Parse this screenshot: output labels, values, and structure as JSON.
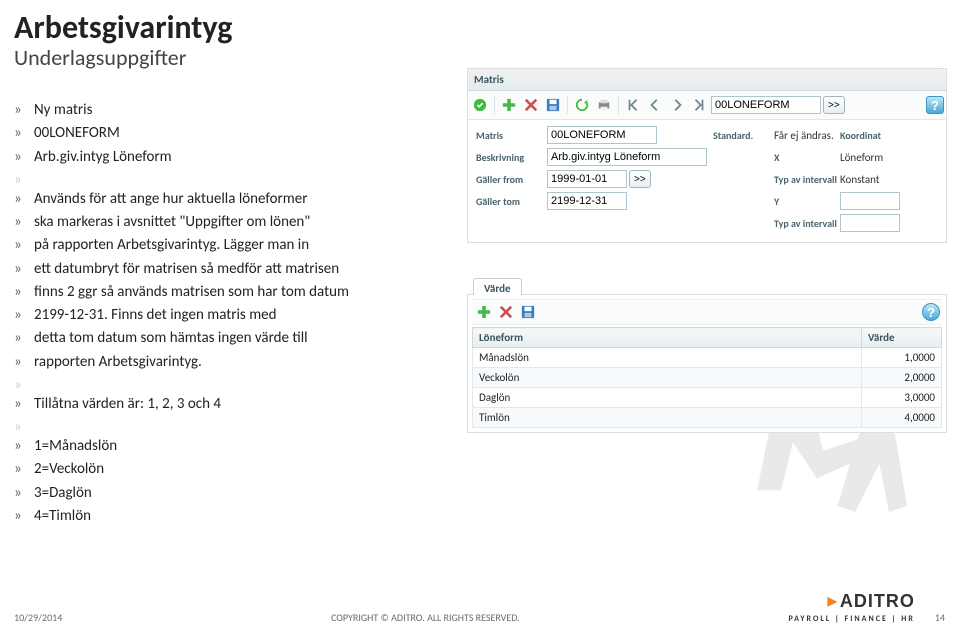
{
  "page": {
    "title": "Arbetsgivarintyg",
    "subtitle": "Underlagsuppgifter"
  },
  "bullets": {
    "b0": "Ny matris",
    "b1": "00LONEFORM",
    "b2": "Arb.giv.intyg Löneform",
    "b3": "Används för att ange hur aktuella löneformer",
    "b4": "ska markeras i avsnittet \"Uppgifter om lönen\"",
    "b5": "på rapporten Arbetsgivarintyg. Lägger man in",
    "b6": "ett datumbryt för matrisen så medför att matrisen",
    "b7": "finns 2 ggr så används matrisen som har tom datum",
    "b8": "2199-12-31. Finns det ingen matris med",
    "b9": "detta tom datum som hämtas ingen värde till",
    "b10": "rapporten Arbetsgivarintyg.",
    "b11": "Tillåtna värden är: 1, 2, 3 och 4",
    "b12": "1=Månadslön",
    "b13": "2=Veckolön",
    "b14": "3=Daglön",
    "b15": "4=Timlön"
  },
  "panel": {
    "header": "Matris",
    "lookup": {
      "value": "00LONEFORM",
      "go": ">>"
    },
    "form": {
      "matris_lbl": "Matris",
      "matris_val": "00LONEFORM",
      "standard_lbl": "Standard.",
      "standard_val": "Får ej ändras.",
      "koordinat_lbl": "Koordinat",
      "beskriv_lbl": "Beskrivning",
      "beskriv_val": "Arb.giv.intyg Löneform",
      "x_lbl": "X",
      "x_val": "Löneform",
      "gfrom_lbl": "Gäller from",
      "gfrom_val": "1999-01-01",
      "typint_lbl": "Typ av intervall",
      "typint_val": "Konstant",
      "gtom_lbl": "Gäller tom",
      "gtom_val": "2199-12-31",
      "y_lbl": "Y",
      "typint2_lbl": "Typ av intervall"
    }
  },
  "subtab": {
    "title": "Värde",
    "col1": "Löneform",
    "col2": "Värde",
    "rows": [
      {
        "name": "Månadslön",
        "val": "1,0000"
      },
      {
        "name": "Veckolön",
        "val": "2,0000"
      },
      {
        "name": "Daglön",
        "val": "3,0000"
      },
      {
        "name": "Timlön",
        "val": "4,0000"
      }
    ]
  },
  "footer": {
    "date": "10/29/2014",
    "copyright": "COPYRIGHT © ADITRO. ALL RIGHTS RESERVED.",
    "page_no": "14",
    "logo_name": "ADITRO",
    "logo_tag": "PAYROLL | FINANCE | HR"
  },
  "icons": {
    "reload": "reload",
    "add": "add",
    "delete": "delete",
    "save": "save",
    "refresh": "refresh",
    "print": "print",
    "first": "first",
    "prev": "prev",
    "next": "next",
    "last": "last",
    "help": "?"
  }
}
